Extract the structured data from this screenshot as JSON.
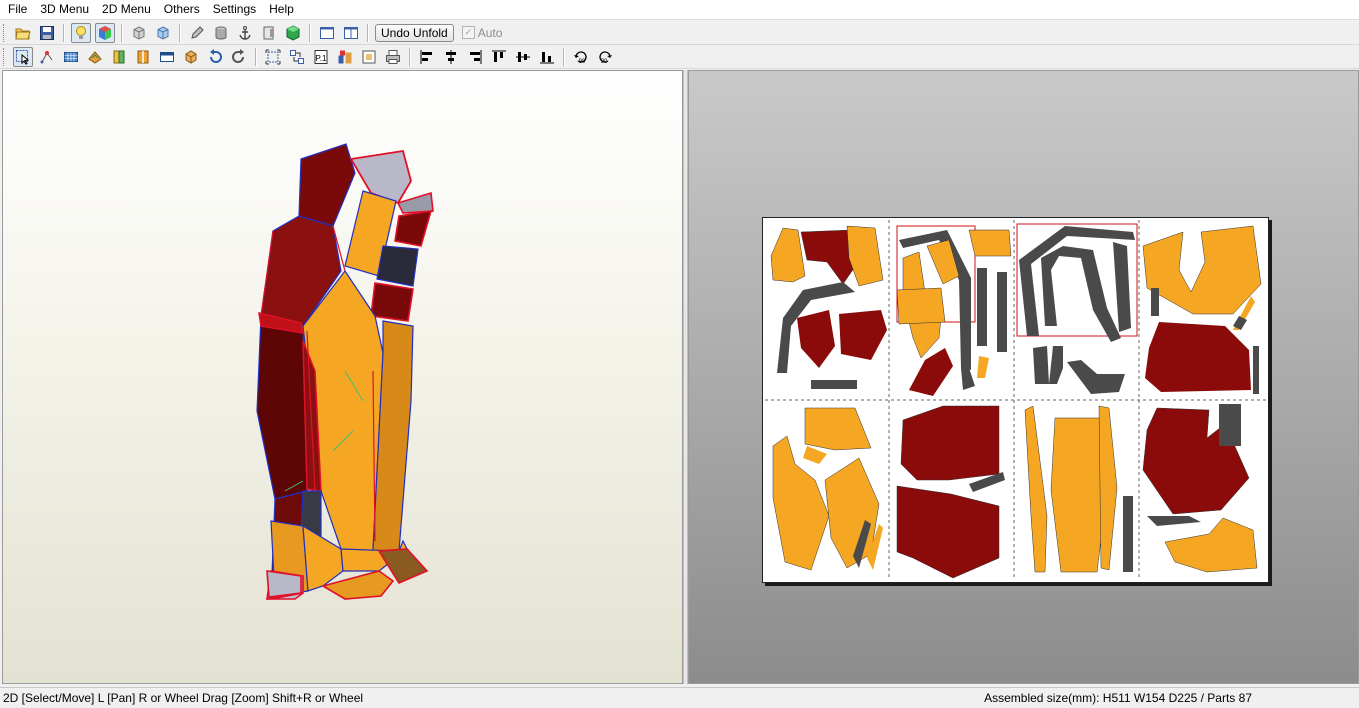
{
  "menu": {
    "file": "File",
    "menu3d": "3D Menu",
    "menu2d": "2D Menu",
    "others": "Others",
    "settings": "Settings",
    "help": "Help"
  },
  "toolbar": {
    "undo_unfold_label": "Undo Unfold",
    "auto_label": "Auto",
    "auto_checked": true,
    "auto_enabled": false
  },
  "status": {
    "left": "2D [Select/Move] L [Pan] R or Wheel Drag [Zoom] Shift+R or Wheel",
    "right": "Assembled size(mm): H511 W154 D225 / Parts 87"
  },
  "colors": {
    "part_orange": "#f5a623",
    "part_darkred": "#8b0a0a",
    "part_gray": "#4a4a4a",
    "edge_red": "#e0102a",
    "edge_blue": "#2030c0"
  }
}
